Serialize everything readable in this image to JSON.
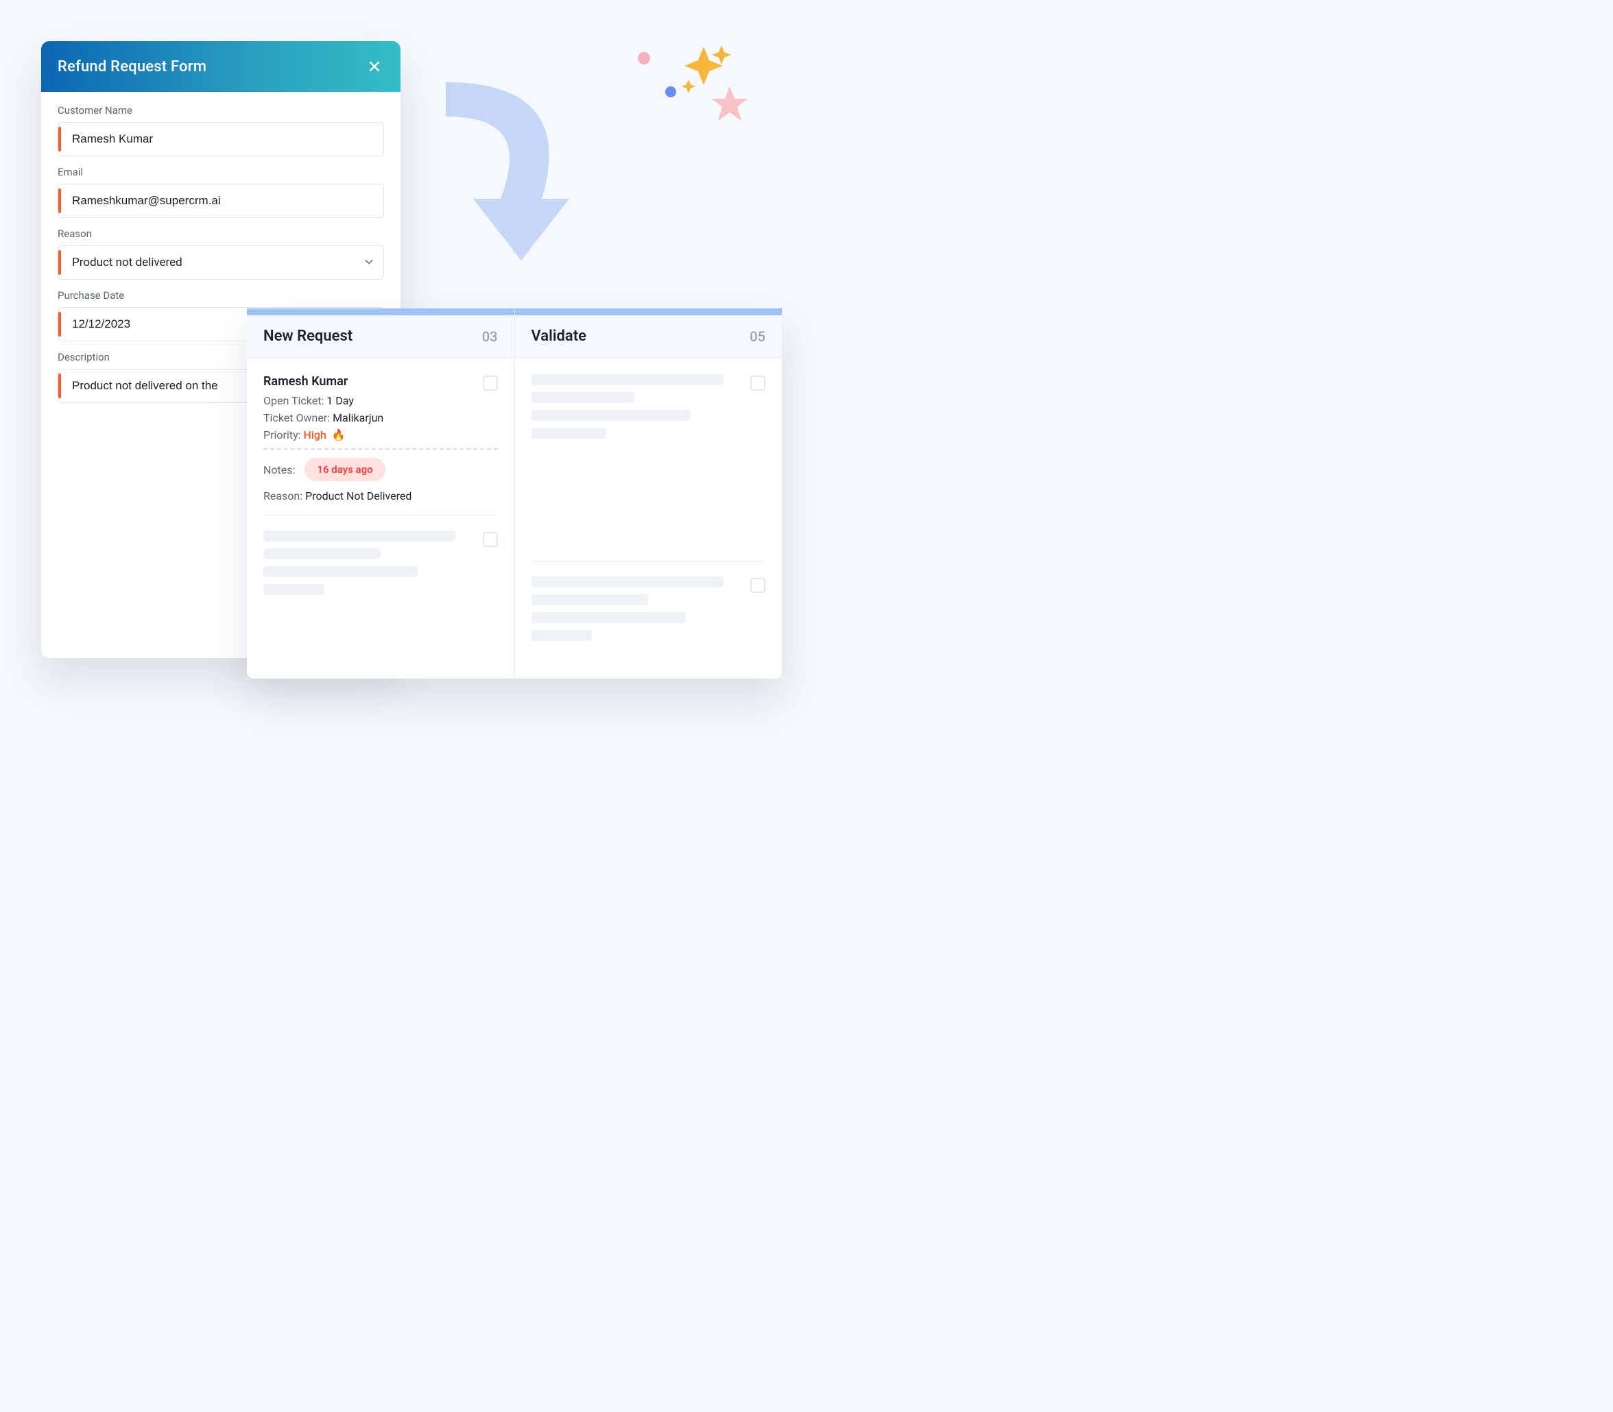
{
  "form": {
    "title": "Refund Request Form",
    "fields": {
      "customerName": {
        "label": "Customer Name",
        "value": "Ramesh Kumar"
      },
      "email": {
        "label": "Email",
        "value": "Rameshkumar@supercrm.ai"
      },
      "reason": {
        "label": "Reason",
        "value": "Product not delivered"
      },
      "purchaseDate": {
        "label": "Purchase Date",
        "value": "12/12/2023"
      },
      "description": {
        "label": "Description",
        "value": "Product not delivered on the"
      }
    }
  },
  "board": {
    "columns": {
      "newRequest": {
        "title": "New Request",
        "count": "03"
      },
      "validate": {
        "title": "Validate",
        "count": "05"
      }
    }
  },
  "ticket": {
    "name": "Ramesh Kumar",
    "openTicketLabel": "Open Ticket: ",
    "openTicketValue": "1 Day",
    "ownerLabel": "Ticket Owner: ",
    "ownerValue": "Malikarjun",
    "priorityLabel": "Priority: ",
    "priorityValue": "High",
    "notesLabel": "Notes:",
    "notesAge": "16 days ago",
    "reasonLabel": "Reason: ",
    "reasonValue": "Product Not Delivered"
  }
}
